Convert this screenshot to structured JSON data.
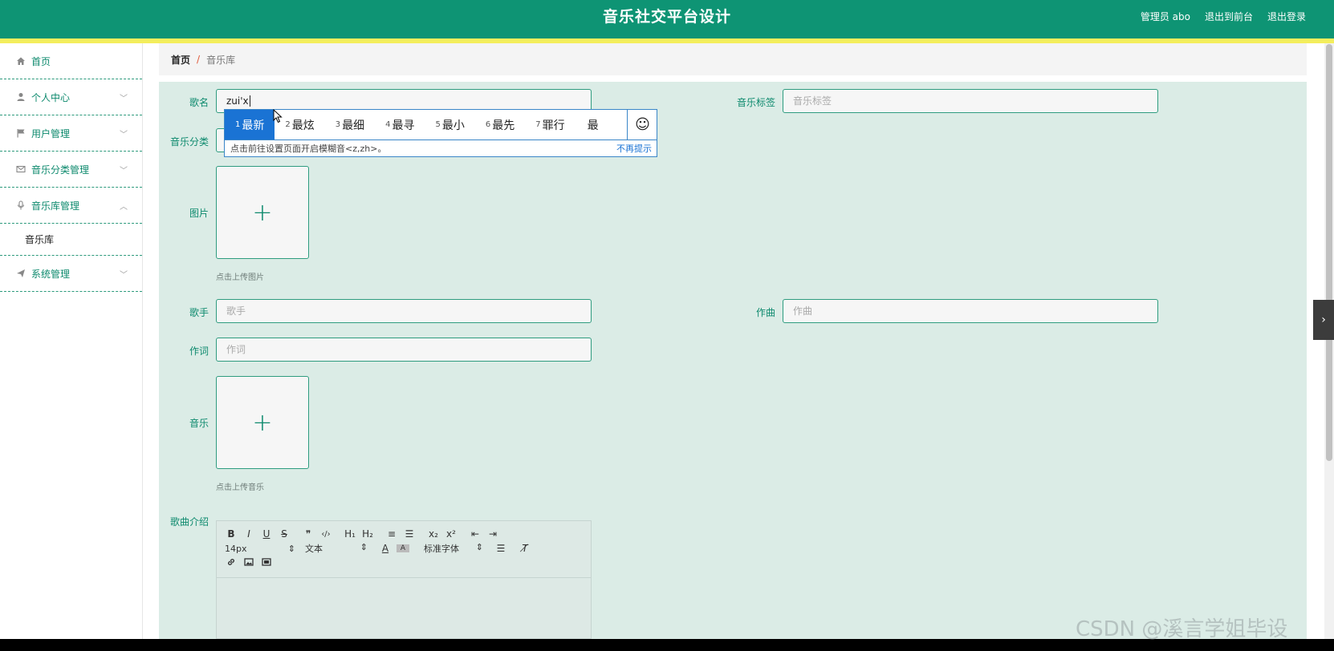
{
  "header": {
    "title": "音乐社交平台设计",
    "admin": "管理员 abo",
    "exit_front": "退出到前台",
    "logout": "退出登录"
  },
  "sidebar": {
    "items": [
      {
        "label": "首页",
        "icon": "home-icon"
      },
      {
        "label": "个人中心",
        "icon": "user-icon"
      },
      {
        "label": "用户管理",
        "icon": "flag-icon"
      },
      {
        "label": "音乐分类管理",
        "icon": "mail-icon"
      },
      {
        "label": "音乐库管理",
        "icon": "microphone-icon"
      },
      {
        "label": "系统管理",
        "icon": "send-icon"
      }
    ],
    "sub_item": "音乐库"
  },
  "breadcrumb": {
    "home": "首页",
    "separator": "/",
    "current": "音乐库"
  },
  "form": {
    "song_name_label": "歌名",
    "song_name_value": "zui'x",
    "tag_label": "音乐标签",
    "tag_placeholder": "音乐标签",
    "category_label": "音乐分类",
    "image_label": "图片",
    "image_hint": "点击上传图片",
    "singer_label": "歌手",
    "singer_placeholder": "歌手",
    "composer_label": "作曲",
    "composer_placeholder": "作曲",
    "lyricist_label": "作词",
    "lyricist_placeholder": "作词",
    "music_label": "音乐",
    "music_hint": "点击上传音乐",
    "intro_label": "歌曲介绍",
    "plus": "+"
  },
  "editor": {
    "font_size": "14px",
    "text_format": "文本",
    "font_family": "标准字体",
    "buttons_row1": [
      "B",
      "I",
      "U",
      "S",
      "❞",
      "‹/›",
      "H₁",
      "H₂",
      "≡",
      "☰",
      "x₂",
      "x²",
      "⇤",
      "⇥"
    ],
    "buttons_row3": [
      "🔗",
      "▣",
      "▤"
    ]
  },
  "ime": {
    "candidates": [
      {
        "num": "1",
        "text": "最新"
      },
      {
        "num": "2",
        "text": "最炫"
      },
      {
        "num": "3",
        "text": "最细"
      },
      {
        "num": "4",
        "text": "最寻"
      },
      {
        "num": "5",
        "text": "最小"
      },
      {
        "num": "6",
        "text": "最先"
      },
      {
        "num": "7",
        "text": "罪行"
      },
      {
        "num": "",
        "text": "最"
      }
    ],
    "tip": "点击前往设置页面开启模糊音<z,zh>。",
    "dismiss": "不再提示",
    "emoji": "☺"
  },
  "watermark": "CSDN @溪言学姐毕设",
  "colors": {
    "header": "#0e9474",
    "stripe": "#f4ee5c",
    "form_bg": "#dbece6",
    "accent": "#0e8a6e",
    "ime_selected": "#1a73d4"
  }
}
